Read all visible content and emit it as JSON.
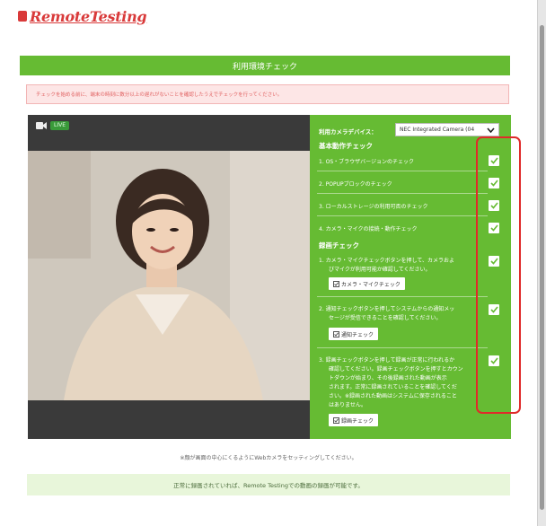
{
  "brand": {
    "name": "RemoteTesting"
  },
  "header": {
    "title": "利用環境チェック"
  },
  "warning": {
    "text": "チェックを始める前に、端末の時刻に数分以上の遅れがないことを確認したうえでチェックを行ってください。"
  },
  "video": {
    "live_badge": "LIVE"
  },
  "panel": {
    "camera_label": "利用カメラデバイス：",
    "camera_select_value": "NEC Integrated Camera (04",
    "section_basic": "基本動作チェック",
    "checks_basic": [
      "1. OS・ブラウザバージョンのチェック",
      "2. POPUPブロックのチェック",
      "3. ローカルストレージの利用可否のチェック",
      "4. カメラ・マイクの接続・動作チェック"
    ],
    "section_record": "録画チェック",
    "step1_lines": [
      "1. カメラ・マイクチェックボタンを押して、カメラおよ",
      "びマイクが利用可能か確認してください。"
    ],
    "step1_button": "カメラ・マイクチェック",
    "step2_lines": [
      "2. 通知チェックボタンを押してシステムからの通知メッ",
      "セージが受信できることを確認してください。"
    ],
    "step2_button": "通知チェック",
    "step3_lines": [
      "3. 録画チェックボタンを押して録画が正常に行われるか",
      "確認してください。録画チェックボタンを押すとカウン",
      "トダウンが始まり、その後録画された動画が表示",
      "されます。正常に録画されていることを確認してくだ",
      "さい。※録画された動画はシステムに保存されること",
      "はありません。"
    ],
    "step3_button": "録画チェック"
  },
  "note": "※顔が画面の中心にくるようにWebカメラをセッティングしてください。",
  "success": "正常に録画されていれば、Remote Testingでの動画の録画が可能です。",
  "colors": {
    "brand_red": "#d93a3a",
    "primary_green": "#66bb33",
    "warn_bg": "#fde6e6",
    "success_bg": "#e8f6da",
    "annotation_red": "#e02a2a"
  }
}
